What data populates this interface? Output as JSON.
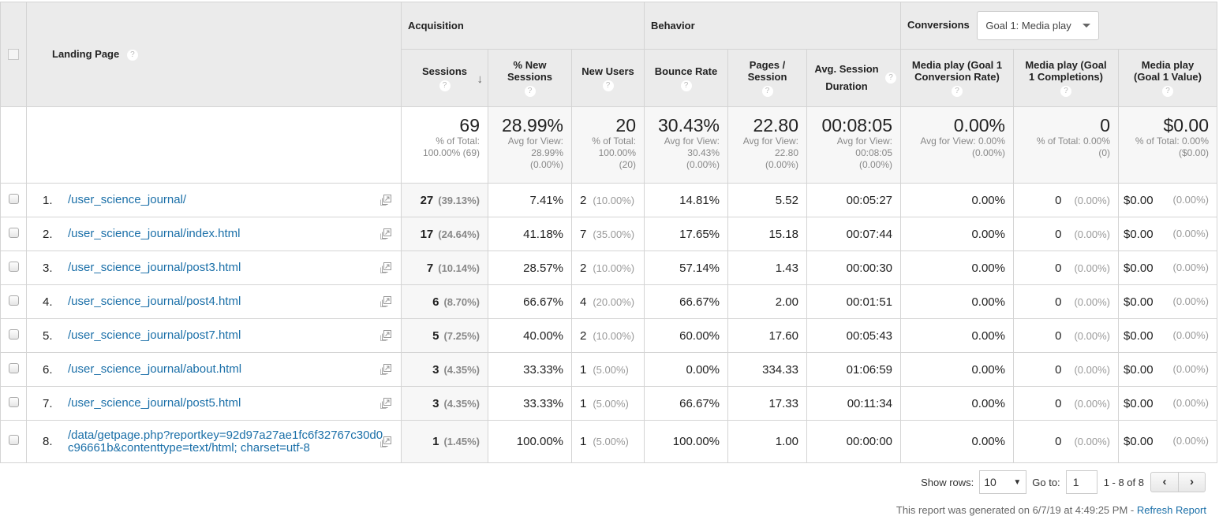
{
  "header": {
    "landing_page": "Landing Page",
    "groups": {
      "acquisition": "Acquisition",
      "behavior": "Behavior",
      "conversions": "Conversions"
    },
    "goal_select": "Goal 1: Media play",
    "columns": {
      "sessions": "Sessions",
      "pct_new_sessions": "% New Sessions",
      "new_users": "New Users",
      "bounce_rate": "Bounce Rate",
      "pages_session": "Pages / Session",
      "avg_session_duration": "Avg. Session Duration",
      "conv_rate": "Media play (Goal 1 Conversion Rate)",
      "completions": "Media play (Goal 1 Completions)",
      "value": "Media play (Goal 1 Value)"
    },
    "help_glyph": "?",
    "sort_glyph": "↓"
  },
  "totals": {
    "sessions": {
      "value": "69",
      "sub": "% of Total: 100.00% (69)"
    },
    "pct_new_sessions": {
      "value": "28.99%",
      "sub": "Avg for View: 28.99% (0.00%)"
    },
    "new_users": {
      "value": "20",
      "sub": "% of Total: 100.00% (20)"
    },
    "bounce_rate": {
      "value": "30.43%",
      "sub": "Avg for View: 30.43% (0.00%)"
    },
    "pages_session": {
      "value": "22.80",
      "sub": "Avg for View: 22.80 (0.00%)"
    },
    "avg_session_duration": {
      "value": "00:08:05",
      "sub": "Avg for View: 00:08:05 (0.00%)"
    },
    "conv_rate": {
      "value": "0.00%",
      "sub": "Avg for View: 0.00% (0.00%)"
    },
    "completions": {
      "value": "0",
      "sub": "% of Total: 0.00% (0)"
    },
    "value": {
      "value": "$0.00",
      "sub": "% of Total: 0.00% ($0.00)"
    }
  },
  "rows": [
    {
      "idx": "1.",
      "page": "/user_science_journal/",
      "sessions": "27",
      "sessions_pct": "(39.13%)",
      "pct_new": "7.41%",
      "new_users": "2",
      "new_users_pct": "(10.00%)",
      "bounce": "14.81%",
      "pps": "5.52",
      "dur": "00:05:27",
      "conv": "0.00%",
      "comp": "0",
      "comp_pct": "(0.00%)",
      "val": "$0.00",
      "val_pct": "(0.00%)"
    },
    {
      "idx": "2.",
      "page": "/user_science_journal/index.html",
      "sessions": "17",
      "sessions_pct": "(24.64%)",
      "pct_new": "41.18%",
      "new_users": "7",
      "new_users_pct": "(35.00%)",
      "bounce": "17.65%",
      "pps": "15.18",
      "dur": "00:07:44",
      "conv": "0.00%",
      "comp": "0",
      "comp_pct": "(0.00%)",
      "val": "$0.00",
      "val_pct": "(0.00%)"
    },
    {
      "idx": "3.",
      "page": "/user_science_journal/post3.html",
      "sessions": "7",
      "sessions_pct": "(10.14%)",
      "pct_new": "28.57%",
      "new_users": "2",
      "new_users_pct": "(10.00%)",
      "bounce": "57.14%",
      "pps": "1.43",
      "dur": "00:00:30",
      "conv": "0.00%",
      "comp": "0",
      "comp_pct": "(0.00%)",
      "val": "$0.00",
      "val_pct": "(0.00%)"
    },
    {
      "idx": "4.",
      "page": "/user_science_journal/post4.html",
      "sessions": "6",
      "sessions_pct": "(8.70%)",
      "pct_new": "66.67%",
      "new_users": "4",
      "new_users_pct": "(20.00%)",
      "bounce": "66.67%",
      "pps": "2.00",
      "dur": "00:01:51",
      "conv": "0.00%",
      "comp": "0",
      "comp_pct": "(0.00%)",
      "val": "$0.00",
      "val_pct": "(0.00%)"
    },
    {
      "idx": "5.",
      "page": "/user_science_journal/post7.html",
      "sessions": "5",
      "sessions_pct": "(7.25%)",
      "pct_new": "40.00%",
      "new_users": "2",
      "new_users_pct": "(10.00%)",
      "bounce": "60.00%",
      "pps": "17.60",
      "dur": "00:05:43",
      "conv": "0.00%",
      "comp": "0",
      "comp_pct": "(0.00%)",
      "val": "$0.00",
      "val_pct": "(0.00%)"
    },
    {
      "idx": "6.",
      "page": "/user_science_journal/about.html",
      "sessions": "3",
      "sessions_pct": "(4.35%)",
      "pct_new": "33.33%",
      "new_users": "1",
      "new_users_pct": "(5.00%)",
      "bounce": "0.00%",
      "pps": "334.33",
      "dur": "01:06:59",
      "conv": "0.00%",
      "comp": "0",
      "comp_pct": "(0.00%)",
      "val": "$0.00",
      "val_pct": "(0.00%)"
    },
    {
      "idx": "7.",
      "page": "/user_science_journal/post5.html",
      "sessions": "3",
      "sessions_pct": "(4.35%)",
      "pct_new": "33.33%",
      "new_users": "1",
      "new_users_pct": "(5.00%)",
      "bounce": "66.67%",
      "pps": "17.33",
      "dur": "00:11:34",
      "conv": "0.00%",
      "comp": "0",
      "comp_pct": "(0.00%)",
      "val": "$0.00",
      "val_pct": "(0.00%)"
    },
    {
      "idx": "8.",
      "page": "/data/getpage.php?reportkey=92d97a27ae1fc6f32767c30d0c96661b&contenttype=text/html; charset=utf-8",
      "sessions": "1",
      "sessions_pct": "(1.45%)",
      "pct_new": "100.00%",
      "new_users": "1",
      "new_users_pct": "(5.00%)",
      "bounce": "100.00%",
      "pps": "1.00",
      "dur": "00:00:00",
      "conv": "0.00%",
      "comp": "0",
      "comp_pct": "(0.00%)",
      "val": "$0.00",
      "val_pct": "(0.00%)"
    }
  ],
  "footer": {
    "show_rows_label": "Show rows:",
    "show_rows_value": "10",
    "goto_label": "Go to:",
    "goto_value": "1",
    "range": "1 - 8 of 8",
    "prev": "‹",
    "next": "›",
    "generated": "This report was generated on 6/7/19 at 4:49:25 PM - ",
    "refresh": "Refresh Report"
  }
}
